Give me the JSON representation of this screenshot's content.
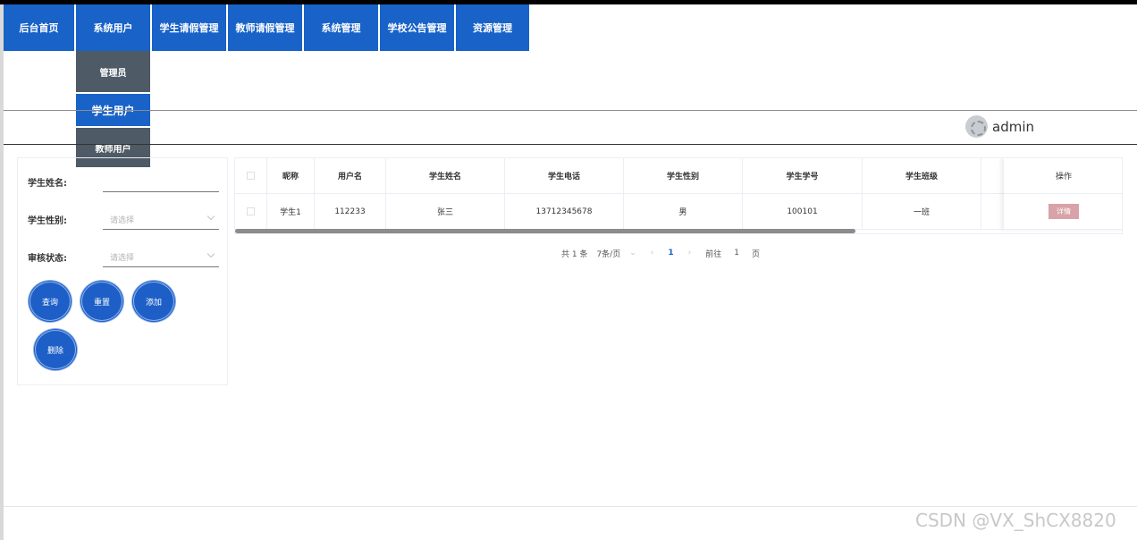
{
  "nav": {
    "items": [
      {
        "label": "后台首页"
      },
      {
        "label": "系统用户"
      },
      {
        "label": "学生请假管理"
      },
      {
        "label": "教师请假管理"
      },
      {
        "label": "系统管理"
      },
      {
        "label": "学校公告管理"
      },
      {
        "label": "资源管理"
      }
    ],
    "submenu": [
      {
        "label": "管理员"
      },
      {
        "label": "学生用户",
        "active": true
      },
      {
        "label": "教师用户"
      }
    ]
  },
  "header": {
    "username": "admin"
  },
  "search": {
    "name_label": "学生姓名:",
    "name_value": "",
    "gender_label": "学生性别:",
    "gender_placeholder": "请选择",
    "status_label": "审核状态:",
    "status_placeholder": "请选择",
    "buttons": {
      "query": "查询",
      "reset": "重置",
      "add": "添加",
      "delete": "删除"
    }
  },
  "table": {
    "columns": [
      "昵称",
      "用户名",
      "学生姓名",
      "学生电话",
      "学生性别",
      "学生学号",
      "学生班级",
      "操作"
    ],
    "rows": [
      {
        "nickname": "学生1",
        "username": "112233",
        "name": "张三",
        "phone": "13712345678",
        "gender": "男",
        "student_no": "100101",
        "class": "一班",
        "action": "详情"
      }
    ]
  },
  "pagination": {
    "total": "共 1 条",
    "page_size": "7条/页",
    "current": "1",
    "goto_label": "前往",
    "goto_value": "1",
    "page_unit": "页"
  },
  "watermark": "CSDN @VX_ShCX8820",
  "colors": {
    "primary": "#1862c8",
    "submenu": "#4e5a65",
    "detail_button": "#d8a2a8"
  }
}
